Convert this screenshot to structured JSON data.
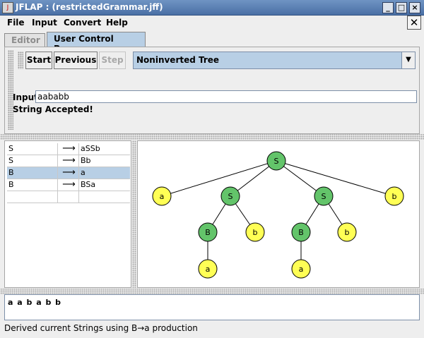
{
  "window": {
    "title": "JFLAP : (restrictedGrammar.jff)"
  },
  "menu": {
    "items": [
      "File",
      "Input",
      "Convert",
      "Help"
    ]
  },
  "tabs": [
    "Editor",
    "User Control Parser"
  ],
  "toolbar": {
    "start_label": "Start",
    "previous_label": "Previous",
    "step_label": "Step",
    "view_select": "Noninverted Tree"
  },
  "input": {
    "label": "Input",
    "value": "aababb"
  },
  "status": "String Accepted!",
  "grammar": {
    "rows": [
      {
        "lhs": "S",
        "arrow": "⟶",
        "rhs": "aSSb"
      },
      {
        "lhs": "S",
        "arrow": "⟶",
        "rhs": "Bb"
      },
      {
        "lhs": "B",
        "arrow": "⟶",
        "rhs": "a"
      },
      {
        "lhs": "B",
        "arrow": "⟶",
        "rhs": "BSa"
      },
      {
        "lhs": "",
        "arrow": "",
        "rhs": ""
      }
    ],
    "selected_index": 2
  },
  "tree": {
    "colors": {
      "nonterminal": "#63c46a",
      "terminal": "#ffff55"
    },
    "nodes": [
      {
        "id": "n0",
        "label": "S",
        "kind": "nonterminal"
      },
      {
        "id": "n1",
        "label": "a",
        "kind": "terminal"
      },
      {
        "id": "n2",
        "label": "S",
        "kind": "nonterminal"
      },
      {
        "id": "n3",
        "label": "S",
        "kind": "nonterminal"
      },
      {
        "id": "n4",
        "label": "b",
        "kind": "terminal"
      },
      {
        "id": "n5",
        "label": "B",
        "kind": "nonterminal"
      },
      {
        "id": "n6",
        "label": "b",
        "kind": "terminal"
      },
      {
        "id": "n7",
        "label": "B",
        "kind": "nonterminal"
      },
      {
        "id": "n8",
        "label": "b",
        "kind": "terminal"
      },
      {
        "id": "n9",
        "label": "a",
        "kind": "terminal"
      },
      {
        "id": "n10",
        "label": "a",
        "kind": "terminal"
      }
    ],
    "edges": [
      [
        "n0",
        "n1"
      ],
      [
        "n0",
        "n2"
      ],
      [
        "n0",
        "n3"
      ],
      [
        "n0",
        "n4"
      ],
      [
        "n2",
        "n5"
      ],
      [
        "n2",
        "n6"
      ],
      [
        "n3",
        "n7"
      ],
      [
        "n3",
        "n8"
      ],
      [
        "n5",
        "n9"
      ],
      [
        "n7",
        "n10"
      ]
    ]
  },
  "derived_string": "a a b a b b",
  "statusbar": "Derived current Strings using B→a production"
}
